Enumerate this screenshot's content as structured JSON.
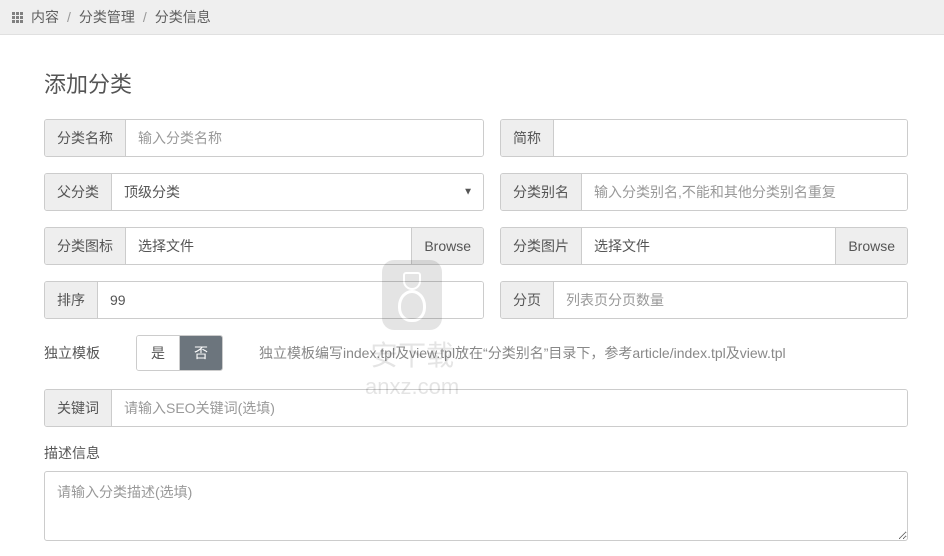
{
  "breadcrumb": {
    "items": [
      "内容",
      "分类管理",
      "分类信息"
    ]
  },
  "page": {
    "title": "添加分类"
  },
  "fields": {
    "name": {
      "label": "分类名称",
      "placeholder": "输入分类名称"
    },
    "short": {
      "label": "简称"
    },
    "parent": {
      "label": "父分类",
      "value": "顶级分类"
    },
    "alias": {
      "label": "分类别名",
      "placeholder": "输入分类别名,不能和其他分类别名重复"
    },
    "icon": {
      "label": "分类图标",
      "file_label": "选择文件",
      "browse": "Browse"
    },
    "image": {
      "label": "分类图片",
      "file_label": "选择文件",
      "browse": "Browse"
    },
    "sort": {
      "label": "排序",
      "value": "99"
    },
    "pagination": {
      "label": "分页",
      "placeholder": "列表页分页数量"
    },
    "template": {
      "label": "独立模板",
      "yes": "是",
      "no": "否",
      "help": "独立模板编写index.tpl及view.tpl放在“分类别名”目录下，参考article/index.tpl及view.tpl"
    },
    "keywords": {
      "label": "关键词",
      "placeholder": "请输入SEO关键词(选填)"
    },
    "description": {
      "label": "描述信息",
      "placeholder": "请输入分类描述(选填)"
    }
  },
  "watermark": {
    "text": "安下载",
    "domain": "anxz.com"
  }
}
